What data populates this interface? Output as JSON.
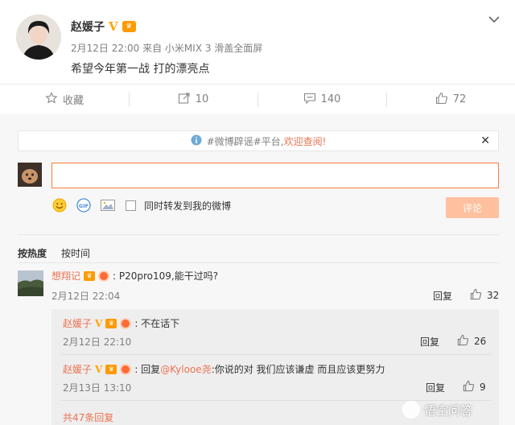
{
  "post": {
    "author": "赵媛子",
    "meta": "2月12日 22:00 来自 小米MIX 3 滑盖全面屏",
    "text": "希望今年第一战 打的漂亮点"
  },
  "actions": {
    "favorite": "收藏",
    "repost": "10",
    "comment": "140",
    "like": "72"
  },
  "notice": {
    "prefix": "#微博辟谣#平台,",
    "link": "欢迎查阅!"
  },
  "composer": {
    "input_value": "",
    "forward_label": "同时转发到我的微博",
    "submit_label": "评论"
  },
  "sort": {
    "hot": "按热度",
    "time": "按时间"
  },
  "comments": [
    {
      "user": "想翔记",
      "text": ": P20pro109,能干过吗?",
      "time": "2月12日 22:04",
      "reply_label": "回复",
      "likes": "32"
    }
  ],
  "replies": [
    {
      "user": "赵媛子",
      "text": ": 不在话下",
      "time": "2月12日 22:10",
      "reply_label": "回复",
      "likes": "26"
    },
    {
      "user": "赵媛子",
      "prefix": ": 回复",
      "mention": "@Kylooe尧",
      "text": ":你说的对 我们应该谦虚 而且应该更努力",
      "time": "2月13日 13:10",
      "reply_label": "回复",
      "likes": "9"
    }
  ],
  "more_replies": "共47条回复",
  "watermark": "悟空问答",
  "colors": {
    "accent": "#eb7350",
    "input_border": "#fa7d3c",
    "submit_disabled": "#ffc09f",
    "vip": "#ffa500"
  }
}
